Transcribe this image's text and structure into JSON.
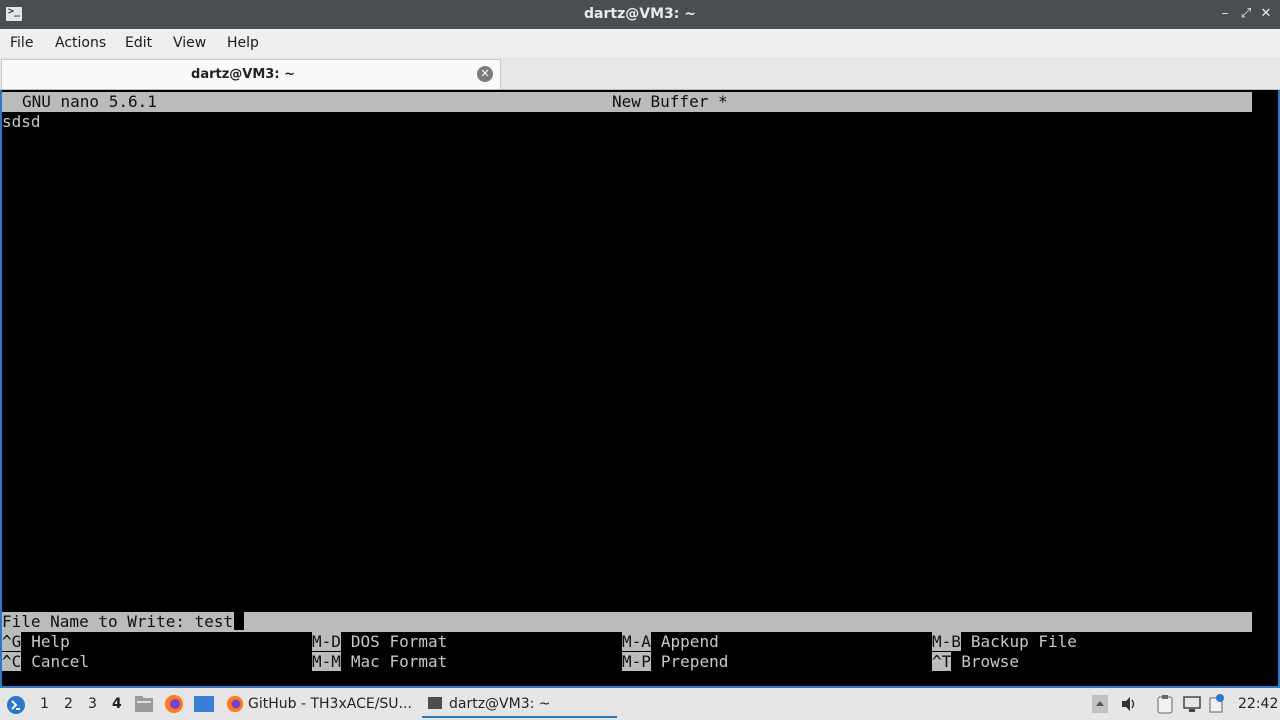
{
  "window": {
    "title": "dartz@VM3: ~",
    "app_icon": ">_",
    "buttons": {
      "minimize": "–",
      "maximize": "⤢",
      "close": "✕"
    }
  },
  "menubar": {
    "items": [
      "File",
      "Actions",
      "Edit",
      "View",
      "Help"
    ]
  },
  "tab": {
    "label": "dartz@VM3: ~",
    "close_icon": "✕"
  },
  "nano": {
    "version": "GNU nano 5.6.1",
    "buffer_name": "New Buffer *",
    "content": "sdsd",
    "prompt_label": "File Name to Write: ",
    "prompt_value": "test",
    "shortcuts": [
      {
        "key": "^G",
        "label": "Help"
      },
      {
        "key": "M-D",
        "label": "DOS Format"
      },
      {
        "key": "M-A",
        "label": "Append"
      },
      {
        "key": "M-B",
        "label": "Backup File"
      },
      {
        "key": "^C",
        "label": "Cancel"
      },
      {
        "key": "M-M",
        "label": "Mac Format"
      },
      {
        "key": "M-P",
        "label": "Prepend"
      },
      {
        "key": "^T",
        "label": "Browse"
      }
    ]
  },
  "taskbar": {
    "workspaces": [
      "1",
      "2",
      "3",
      "4"
    ],
    "active_workspace": "4",
    "tasks": [
      {
        "label": "GitHub - TH3xACE/SU..."
      },
      {
        "label": "dartz@VM3: ~"
      }
    ],
    "clock": "22:42"
  },
  "colors": {
    "accent": "#2b78c9",
    "nano_bar": "#bbbbbb",
    "terminal_bg": "#000000"
  }
}
